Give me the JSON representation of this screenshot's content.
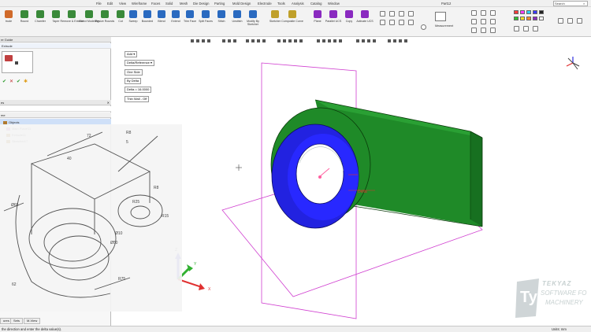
{
  "menu": [
    "File",
    "Edit",
    "View",
    "Wireframe",
    "Faces",
    "Solid",
    "Mesh",
    "Die Design",
    "Parting",
    "Mold Design",
    "Electrode",
    "Tools",
    "Analysis",
    "Catalog",
    "Window"
  ],
  "window_title": "Part12",
  "search": {
    "label": "Search"
  },
  "ribbon": {
    "groups": [
      {
        "label": "trude",
        "color": "#d06a2a"
      },
      {
        "label": "Round",
        "color": "#3a8a3a"
      },
      {
        "label": "Chamfer",
        "color": "#3a8a3a"
      },
      {
        "label": "Taper",
        "color": "#3a8a3a"
      },
      {
        "label": "Remove & Extend",
        "color": "#3a8a3a"
      },
      {
        "label": "Direct Modeling",
        "color": "#3a8a3a"
      },
      {
        "label": "Resize Rounds",
        "color": "#3a8a3a"
      },
      {
        "label": "Cut",
        "color": "#3a8a3a"
      },
      {
        "label": "Sweep",
        "color": "#2a6ac0"
      },
      {
        "label": "Bounded",
        "color": "#2a6ac0"
      },
      {
        "label": "Blend",
        "color": "#2a6ac0"
      },
      {
        "label": "Extend",
        "color": "#2a6ac0"
      },
      {
        "label": "Trim Face",
        "color": "#2a6ac0"
      },
      {
        "label": "Split Faces",
        "color": "#2a6ac0"
      },
      {
        "label": "Stitch",
        "color": "#2a6ac0"
      },
      {
        "label": "Unstitch",
        "color": "#2a6ac0"
      },
      {
        "label": "Modify By Sketcher",
        "color": "#2a6ac0"
      },
      {
        "label": "Sketcher",
        "color": "#c0a02a"
      },
      {
        "label": "Composite Curve",
        "color": "#c0a02a"
      },
      {
        "label": "Plane",
        "color": "#8a2ac0"
      },
      {
        "label": "Parallel UCS",
        "color": "#8a2ac0"
      },
      {
        "label": "Copy",
        "color": "#8a2ac0"
      },
      {
        "label": "Activate UCS",
        "color": "#8a2ac0"
      }
    ],
    "measurement_label": "Measurement"
  },
  "left_panel": {
    "guide_title": "re Guide",
    "extrude_label": "Extrude",
    "tree_title": "es",
    "tree_column": "me",
    "tree_items": [
      {
        "label": "Objects",
        "color": "#b07a30"
      },
      {
        "label": "Main Plane11",
        "color": "#c070c0"
      },
      {
        "label": "Extrude11",
        "color": "#b07a30"
      },
      {
        "label": "Sketcher17",
        "color": "#b07a30"
      }
    ],
    "bottom_tabs": [
      "ures",
      "Sets",
      "M-View"
    ]
  },
  "options": {
    "add": "Add",
    "delta_reference": "Delta/Reference",
    "one_side": "One Side",
    "by_delta": "By Delta",
    "delta_value": "Delta = 16.0000",
    "thin_wall": "Thin Wall - Off"
  },
  "viewport": {
    "annotation": "Delta",
    "axis_x": "X",
    "axis_y": "Y",
    "axis_z": "Z"
  },
  "drawing": {
    "dims": [
      "72",
      "R8",
      "5",
      "40",
      "R8",
      "R15",
      "R25",
      "Ø65",
      "Ø50",
      "R75",
      "62",
      "Ø10"
    ]
  },
  "status": {
    "prompt": "the direction and enter the delta value(s).",
    "units": "Units: mm"
  },
  "watermark": {
    "brand": "TEKYAZ",
    "line1": "SOFTWARE FO",
    "line2": "MACHINERY"
  },
  "colors": {
    "solid_green": "#1f8a28",
    "solid_blue": "#2222e0",
    "plane_magenta": "#d040d0",
    "accent_orange": "#e07020"
  }
}
